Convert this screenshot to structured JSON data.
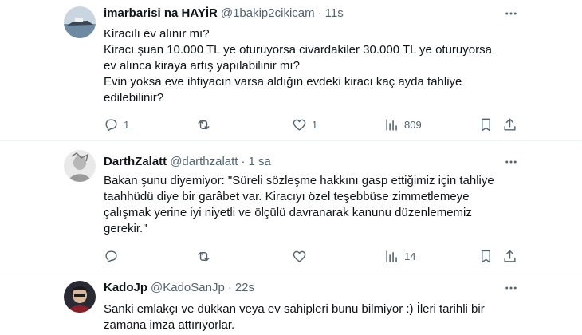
{
  "tweets": [
    {
      "name": "imarbarisi na HAYİR",
      "handle": "@1bakip2cikicam",
      "separator": "·",
      "time": "11s",
      "lines": [
        "Kiracılı ev alınır mı?",
        "Kiracı şuan 10.000 TL ye oturuyorsa civardakiler 30.000 TL ye oturuyorsa",
        "ev alınca kiraya artış yapılabilinir mı?",
        "Evin yoksa eve ihtiyacın varsa aldığın evdeki kiracı kaç ayda tahliye",
        "edilebilinir?"
      ],
      "replies": "1",
      "retweets": "",
      "likes": "1",
      "views": "809"
    },
    {
      "name": "DarthZalatt",
      "handle": "@darthzalatt",
      "separator": "·",
      "time": "1 sa",
      "lines": [
        "Bakan şunu diyemiyor: \"Süreli sözleşme hakkını gasp ettiğimiz için tahliye",
        "taahhüdü diye bir garâbet var. Kiracıyı özel teşebbüse zimmetlemeye",
        "çalışmak yerine iyi niyetli ve ölçülü davranarak kanunu düzenlememiz",
        "gerekir.\""
      ],
      "replies": "",
      "retweets": "",
      "likes": "",
      "views": "14"
    },
    {
      "name": "KadoJp",
      "handle": "@KadoSanJp",
      "separator": "·",
      "time": "22s",
      "lines": [
        "Sanki emlakçı ve dükkan veya ev sahipleri bunu bilmiyor :) İleri tarihli bir",
        "zamana imza attırıyorlar."
      ]
    }
  ],
  "icons": {
    "reply": "reply-icon",
    "retweet": "retweet-icon",
    "like": "heart-icon",
    "views": "views-icon",
    "bookmark": "bookmark-icon",
    "share": "share-icon",
    "more": "more-icon"
  },
  "colors": {
    "text": "#0f1419",
    "secondary": "#536471",
    "divider": "#eff3f4"
  }
}
